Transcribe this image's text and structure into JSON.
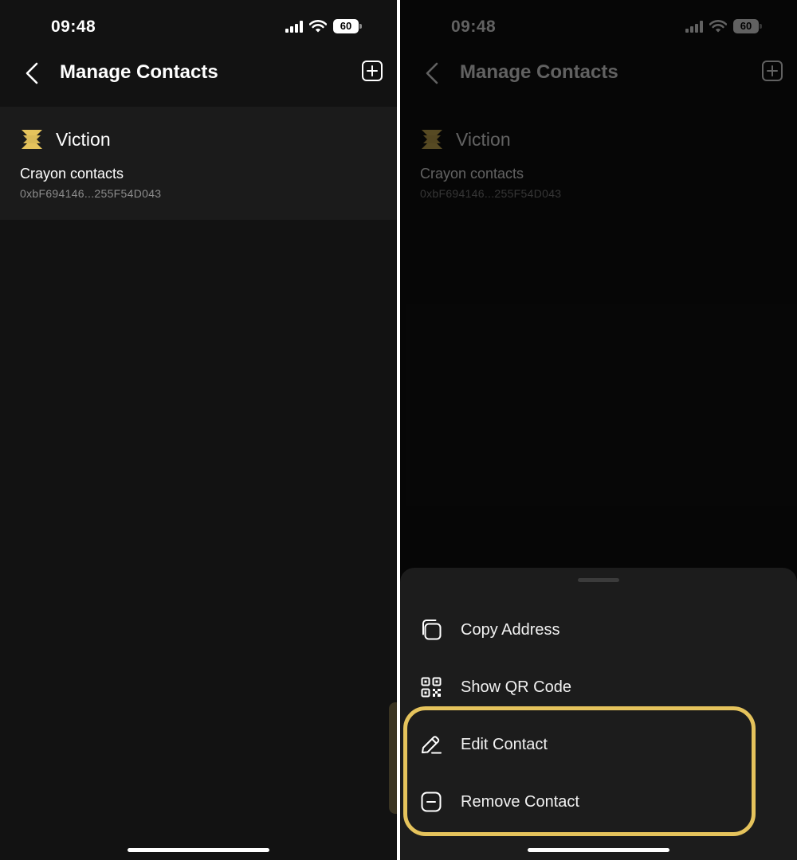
{
  "status_bar": {
    "time": "09:48",
    "battery": "60"
  },
  "header": {
    "title": "Manage Contacts"
  },
  "contact": {
    "network": "Viction",
    "name": "Crayon contacts",
    "address": "0xbF694146...255F54D043"
  },
  "action_sheet": {
    "items": [
      {
        "label": "Copy Address",
        "icon": "copy-icon"
      },
      {
        "label": "Show QR Code",
        "icon": "qr-code-icon"
      },
      {
        "label": "Edit Contact",
        "icon": "pencil-icon"
      },
      {
        "label": "Remove Contact",
        "icon": "minus-square-icon"
      }
    ]
  },
  "colors": {
    "background": "#121212",
    "card": "#1b1b1b",
    "sheet": "#1c1c1c",
    "accent": "#e5c35c",
    "secondary_text": "#8c8c8c"
  }
}
